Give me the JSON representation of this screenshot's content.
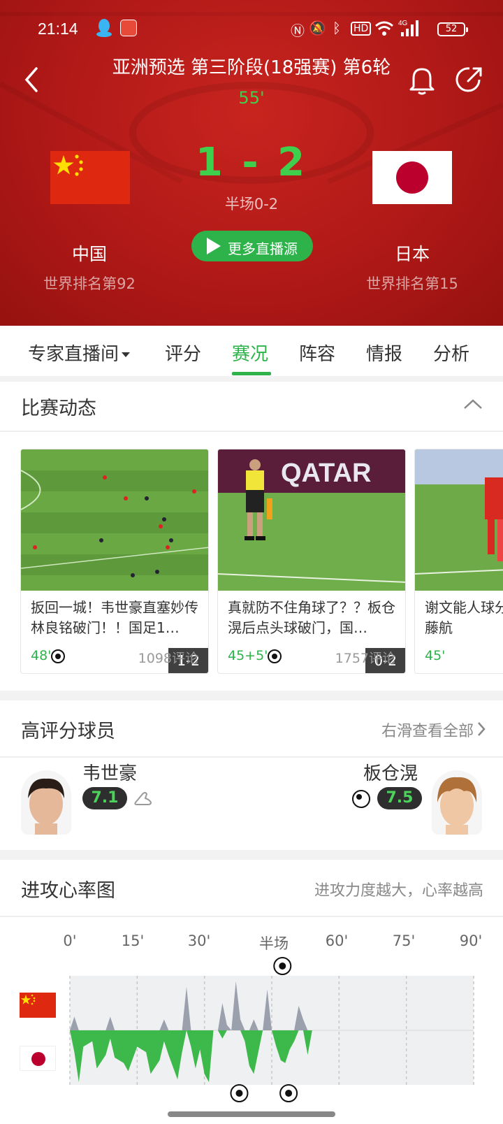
{
  "status_bar": {
    "time": "21:14",
    "battery": "52"
  },
  "header": {
    "title": "亚洲预选 第三阶段(18强赛) 第6轮",
    "minute": "55'",
    "score": "1 - 2",
    "halftime": "半场0-2",
    "more_sources": "更多直播源",
    "home": {
      "name": "中国",
      "rank": "世界排名第92"
    },
    "away": {
      "name": "日本",
      "rank": "世界排名第15"
    }
  },
  "tabs": [
    "专家直播间",
    "评分",
    "赛况",
    "阵容",
    "情报",
    "分析"
  ],
  "active_tab": "赛况",
  "events_section": {
    "title": "比赛动态",
    "cards": [
      {
        "score": "1-2",
        "text": "扳回一城！韦世豪直塞妙传林良铭破门！！国足1…",
        "minute": "48'",
        "comments": "1098评论"
      },
      {
        "score": "0-2",
        "text": "真就防不住角球了？？板仓滉后点头球破门，国…",
        "minute": "45+5'",
        "comments": "1757评论"
      },
      {
        "score": "",
        "text": "谢文能人球分藤航",
        "minute": "45'",
        "comments": ""
      }
    ]
  },
  "players_section": {
    "title": "高评分球员",
    "right_link": "右滑查看全部",
    "home_player": {
      "name": "韦世豪",
      "rating": "7.1"
    },
    "away_player": {
      "name": "板仓滉",
      "rating": "7.5"
    }
  },
  "heart_section": {
    "title": "进攻心率图",
    "subtitle": "进攻力度越大，心率越高",
    "ticks": [
      "0'",
      "15'",
      "30'",
      "半场",
      "60'",
      "75'",
      "90'"
    ]
  },
  "colors": {
    "brand_green": "#2db34a",
    "header_red": "#b01917",
    "home_series": "#9aa0ac",
    "away_series": "#3db84a"
  },
  "chart_data": {
    "type": "area",
    "x_ticks": [
      "0'",
      "15'",
      "30'",
      "半场",
      "60'",
      "75'",
      "90'"
    ],
    "series": [
      {
        "x": [
          0,
          1,
          2,
          3,
          5,
          6,
          8,
          9,
          10,
          12,
          13,
          15,
          17,
          18,
          20,
          21,
          22,
          24,
          25,
          26,
          27,
          28,
          29,
          30,
          31,
          32,
          33,
          34,
          35,
          36,
          37,
          38,
          39,
          40,
          41,
          42,
          43,
          44,
          45,
          46,
          47,
          48,
          49,
          50,
          51,
          52,
          53,
          54,
          55
        ],
        "values": [
          0,
          0.25,
          0,
          0,
          0,
          0,
          0,
          0.25,
          0,
          0,
          0,
          0,
          0,
          0,
          0,
          0.2,
          0,
          0,
          0,
          0.8,
          0,
          0,
          0,
          0,
          0,
          0,
          0,
          0.5,
          0.1,
          0,
          0.9,
          0.2,
          0,
          0,
          0.2,
          0,
          0,
          0.75,
          0,
          0,
          0,
          0,
          0,
          0,
          0.45,
          0.2,
          0,
          0,
          0
        ]
      },
      {
        "x": [
          0,
          1,
          2,
          3,
          5,
          6,
          8,
          9,
          10,
          12,
          13,
          15,
          17,
          18,
          20,
          21,
          22,
          24,
          25,
          26,
          27,
          28,
          29,
          30,
          31,
          32,
          33,
          34,
          35,
          36,
          37,
          38,
          39,
          40,
          41,
          42,
          43,
          44,
          45,
          46,
          47,
          48,
          49,
          50,
          51,
          52,
          53,
          54,
          55
        ],
        "values": [
          0,
          -0.4,
          -0.95,
          -0.3,
          -0.2,
          -0.7,
          -0.45,
          -0.15,
          -0.5,
          -0.6,
          -0.75,
          -0.3,
          -0.4,
          -0.8,
          -0.55,
          -0.2,
          -0.45,
          -0.9,
          -0.4,
          0,
          -0.3,
          -0.7,
          -0.35,
          -0.8,
          -0.95,
          0,
          0,
          -0.15,
          0,
          0,
          0,
          0,
          -0.2,
          -0.65,
          -0.8,
          -0.4,
          0,
          0,
          0,
          -0.3,
          -0.55,
          -0.6,
          -0.35,
          -0.2,
          0,
          0,
          -0.45,
          0,
          0
        ]
      }
    ],
    "goals_home_minutes": [
      48
    ],
    "goals_away_minutes": [
      39,
      50
    ],
    "ylim": [
      -1,
      1
    ]
  }
}
